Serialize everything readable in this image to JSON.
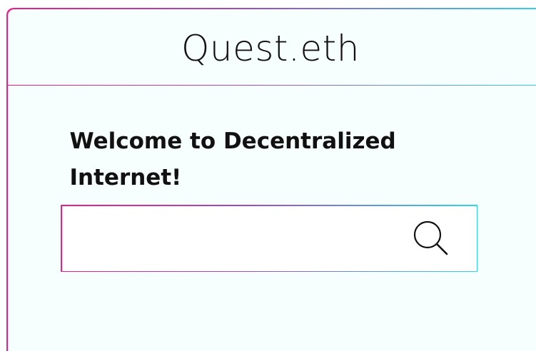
{
  "app": {
    "title": "Quest.eth"
  },
  "main": {
    "heading": "Welcome to Decentralized Internet!"
  },
  "search": {
    "value": "",
    "placeholder": "",
    "icon": "search-icon"
  },
  "colors": {
    "gradient_start": "#e91e8c",
    "gradient_end": "#2fd6e8",
    "background": "#f7fefe",
    "text": "#111111"
  }
}
